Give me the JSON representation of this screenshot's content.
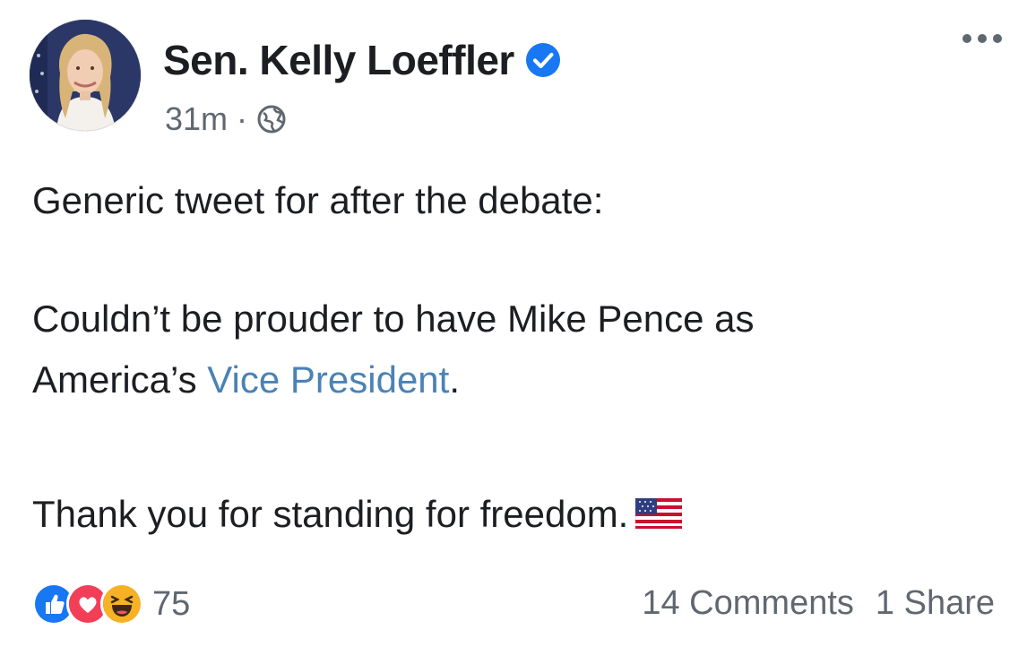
{
  "post": {
    "author": "Sen. Kelly Loeffler",
    "timestamp": "31m",
    "separator": "·",
    "audience_icon": "globe-icon",
    "verified_icon": "verified-badge-icon",
    "more_icon": "more-options-icon",
    "lines": {
      "line1": "Generic tweet for after the debate:",
      "line2": "Couldn’t be prouder to have Mike Pence as",
      "line3_prefix": "America’s ",
      "line3_link": "Vice President",
      "line3_suffix": ".",
      "line4": "Thank you for standing for freedom."
    },
    "flag_icon": "us-flag-icon",
    "reactions": {
      "icons": [
        "like-icon",
        "love-icon",
        "haha-icon"
      ],
      "count": "75"
    },
    "comments_label": "14 Comments",
    "shares_label": "1 Share"
  },
  "colors": {
    "link": "#4b82b5",
    "muted": "#606770",
    "text": "#1c1e21",
    "verified": "#1877f2",
    "like": "#1877f2",
    "love": "#f33e58",
    "haha": "#f7b125"
  }
}
